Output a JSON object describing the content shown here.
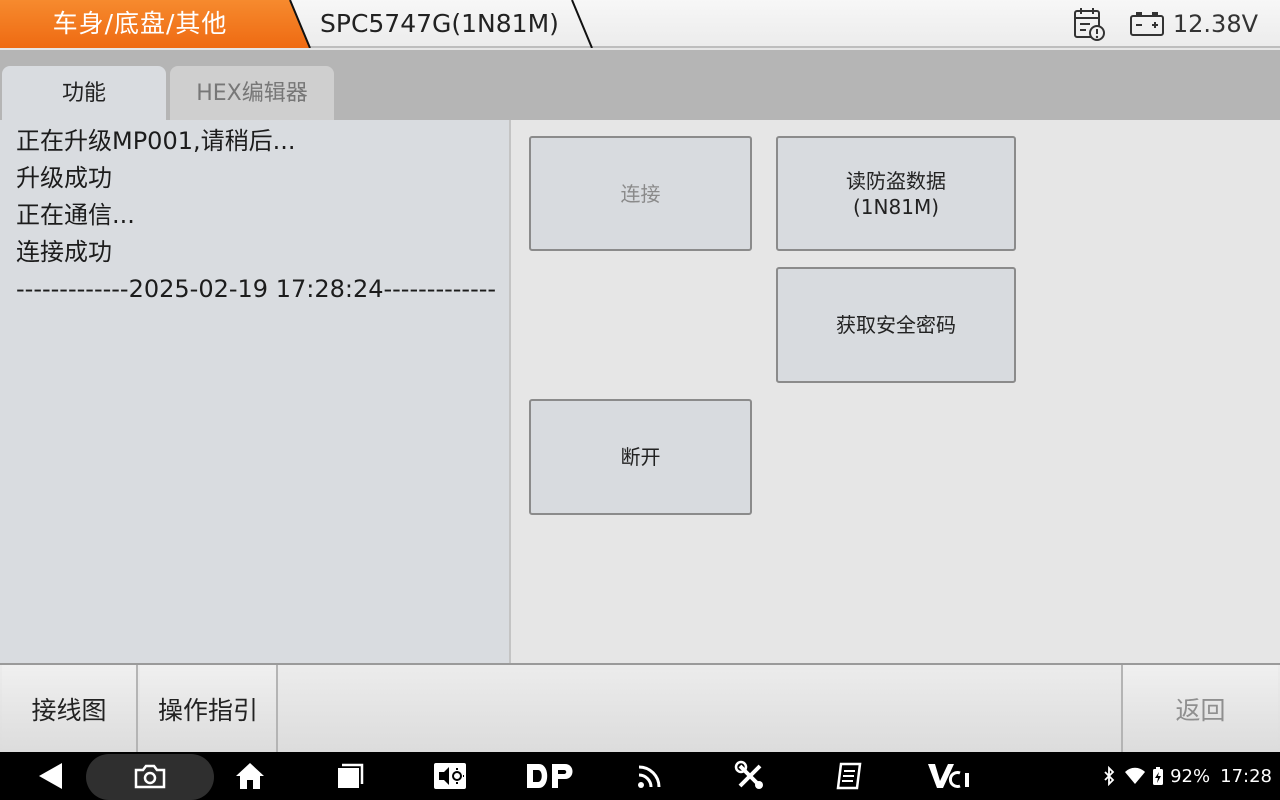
{
  "header": {
    "breadcrumb_active": "车身/底盘/其他",
    "breadcrumb_current": "SPC5747G(1N81M)",
    "report_icon": "calendar-clock-icon",
    "battery_icon": "car-battery-icon",
    "voltage": "12.38V",
    "accent_color": "#f47a20"
  },
  "tabs": [
    {
      "label": "功能",
      "active": true
    },
    {
      "label": "HEX编辑器",
      "active": false
    }
  ],
  "log": {
    "lines": [
      "正在升级MP001,请稍后...",
      "升级成功",
      "正在通信...",
      "连接成功",
      "-------------2025-02-19 17:28:24-------------"
    ]
  },
  "functions": {
    "connect": "连接",
    "read_immo_line1": "读防盗数据",
    "read_immo_line2": "(1N81M)",
    "get_security_code": "获取安全密码",
    "disconnect": "断开"
  },
  "actions": {
    "wiring": "接线图",
    "guide": "操作指引",
    "back": "返回"
  },
  "navbar": {
    "icons": [
      "back-icon",
      "screenshot-icon",
      "home-icon",
      "recent-apps-icon",
      "screen-brightness-icon",
      "dp-icon",
      "wifi-signal-icon",
      "tools-icon",
      "manual-icon",
      "vci-icon"
    ],
    "vci_label": "VCI",
    "dp_label": "DP",
    "battery_percent": "92%",
    "time": "17:28"
  }
}
